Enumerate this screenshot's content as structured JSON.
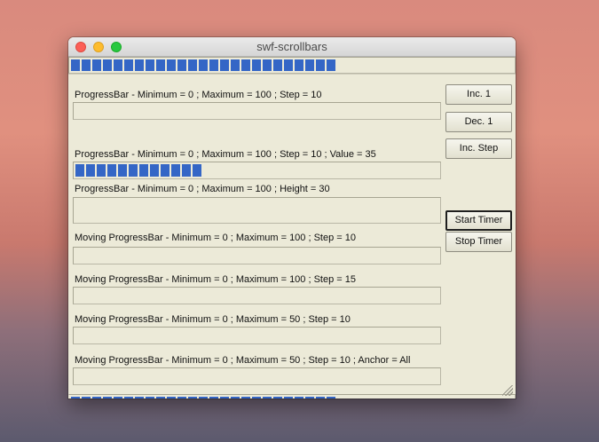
{
  "window": {
    "title": "swf-scrollbars"
  },
  "top_bar": {
    "value": 60,
    "maximum": 100
  },
  "bottom_bar": {
    "value": 60,
    "maximum": 100
  },
  "progress_rows": [
    {
      "label": "ProgressBar - Minimum = 0 ; Maximum = 100 ; Step = 10",
      "value": 0,
      "maximum": 100
    },
    {
      "label": "ProgressBar - Minimum = 0 ; Maximum = 100 ; Step = 10 ; Value = 35",
      "value": 35,
      "maximum": 100
    },
    {
      "label": "ProgressBar - Minimum = 0 ; Maximum = 100 ; Height = 30",
      "value": 0,
      "maximum": 100
    },
    {
      "label": "Moving ProgressBar - Minimum = 0 ; Maximum = 100 ; Step = 10",
      "value": 0,
      "maximum": 100
    },
    {
      "label": "Moving ProgressBar - Minimum = 0 ; Maximum = 100 ; Step = 15",
      "value": 0,
      "maximum": 100
    },
    {
      "label": "Moving ProgressBar - Minimum = 0 ; Maximum = 50 ; Step = 10",
      "value": 0,
      "maximum": 50
    },
    {
      "label": "Moving ProgressBar - Minimum = 0 ; Maximum = 50 ; Step = 10 ; Anchor = All",
      "value": 0,
      "maximum": 50
    }
  ],
  "buttons": {
    "inc1": "Inc. 1",
    "dec1": "Dec. 1",
    "inc_step": "Inc. Step",
    "start_timer": "Start Timer",
    "stop_timer": "Stop Timer"
  },
  "colors": {
    "chunk": "#3466c6",
    "window_bg": "#ecead8"
  }
}
